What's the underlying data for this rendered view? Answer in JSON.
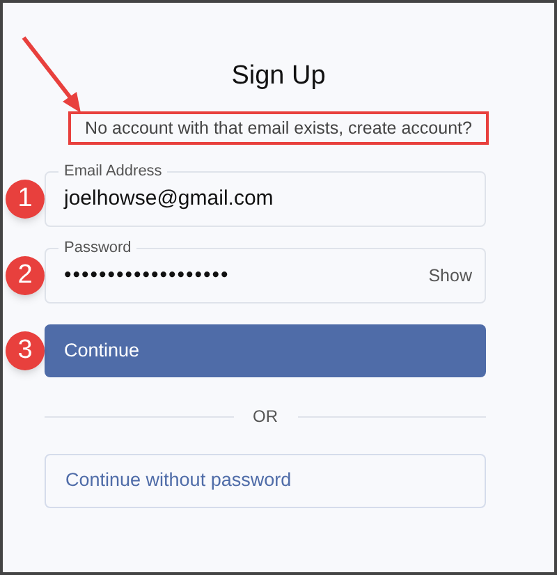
{
  "title": "Sign Up",
  "message": "No account with that email exists, create account?",
  "fields": [
    {
      "kind": "text",
      "label": "Email Address",
      "value": "joelhowse@gmail.com",
      "badge": "1"
    },
    {
      "kind": "password",
      "label": "Password",
      "value": "•••••••••••••••••••",
      "toggle": "Show",
      "badge": "2"
    }
  ],
  "primary_button": {
    "label": "Continue",
    "badge": "3"
  },
  "divider": "OR",
  "secondary_button": {
    "label": "Continue without password"
  }
}
